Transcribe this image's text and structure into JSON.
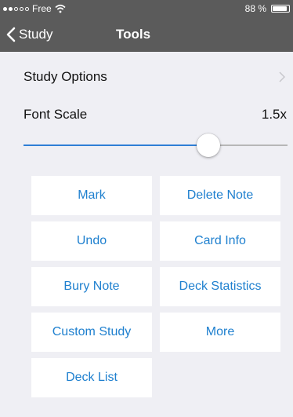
{
  "status_bar": {
    "carrier": "Free",
    "battery": "88 %",
    "battery_level": 0.88,
    "signal_bars_filled": 2,
    "signal_bars_total": 5
  },
  "nav": {
    "back_label": "Study",
    "title": "Tools"
  },
  "settings": {
    "study_options_label": "Study Options",
    "font_scale_label": "Font Scale",
    "font_scale_value": "1.5x",
    "font_scale_fraction": 0.7
  },
  "tools": {
    "mark": "Mark",
    "delete_note": "Delete Note",
    "undo": "Undo",
    "card_info": "Card Info",
    "bury_note": "Bury Note",
    "deck_statistics": "Deck Statistics",
    "custom_study": "Custom Study",
    "more": "More",
    "deck_list": "Deck List"
  },
  "colors": {
    "nav_background": "#5b5b5b",
    "page_background": "#efeff4",
    "accent": "#1f80cf",
    "slider_fill": "#2f7fd6"
  }
}
